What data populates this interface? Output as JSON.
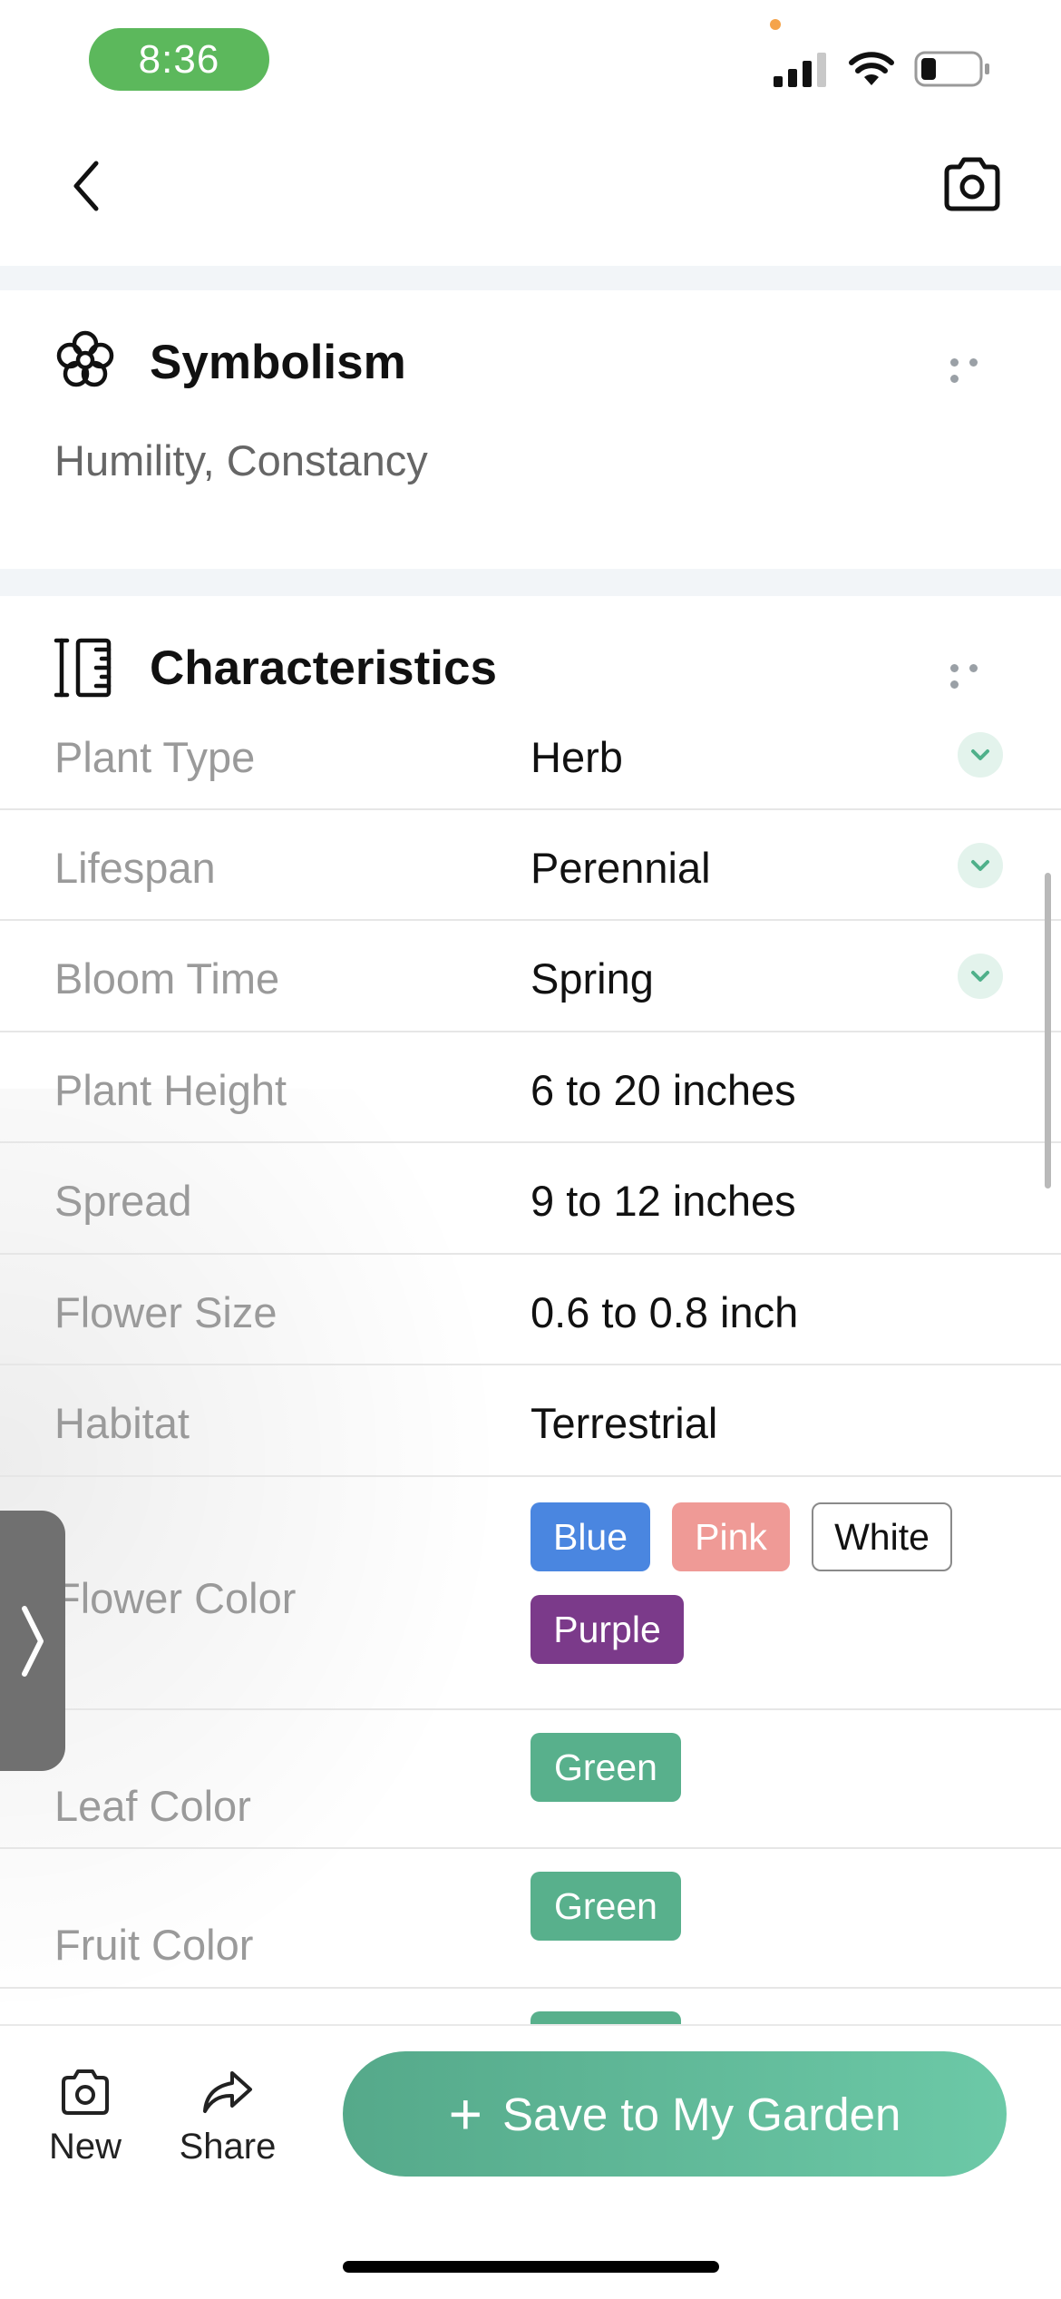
{
  "status_bar": {
    "time": "8:36"
  },
  "symbolism": {
    "title": "Symbolism",
    "text": "Humility, Constancy"
  },
  "characteristics": {
    "title": "Characteristics",
    "rows": [
      {
        "label": "Plant Type",
        "value": "Herb"
      },
      {
        "label": "Lifespan",
        "value": "Perennial"
      },
      {
        "label": "Bloom Time",
        "value": "Spring"
      },
      {
        "label": "Plant Height",
        "value": "6 to 20 inches"
      },
      {
        "label": "Spread",
        "value": "9 to 12 inches"
      },
      {
        "label": "Flower Size",
        "value": "0.6 to 0.8 inch"
      },
      {
        "label": "Habitat",
        "value": "Terrestrial"
      },
      {
        "label": "Flower Color",
        "tags": [
          "Blue",
          "Pink",
          "White",
          "Purple"
        ]
      },
      {
        "label": "Leaf Color",
        "tags": [
          "Green"
        ]
      },
      {
        "label": "Fruit Color",
        "tags": [
          "Green"
        ]
      }
    ]
  },
  "toolbar": {
    "new_label": "New",
    "share_label": "Share",
    "save_label": "Save to My Garden"
  },
  "colors": {
    "tag_blue": "#4a86e0",
    "tag_pink": "#ef9a96",
    "tag_white": "#ffffff",
    "tag_purple": "#7b3a8a",
    "tag_green": "#58b08c",
    "accent": "#5cb89a"
  },
  "icons": [
    "back-arrow-icon",
    "camera-icon",
    "flower-icon",
    "ruler-icon",
    "more-icon",
    "chevron-down-icon",
    "share-icon",
    "plus-icon"
  ]
}
